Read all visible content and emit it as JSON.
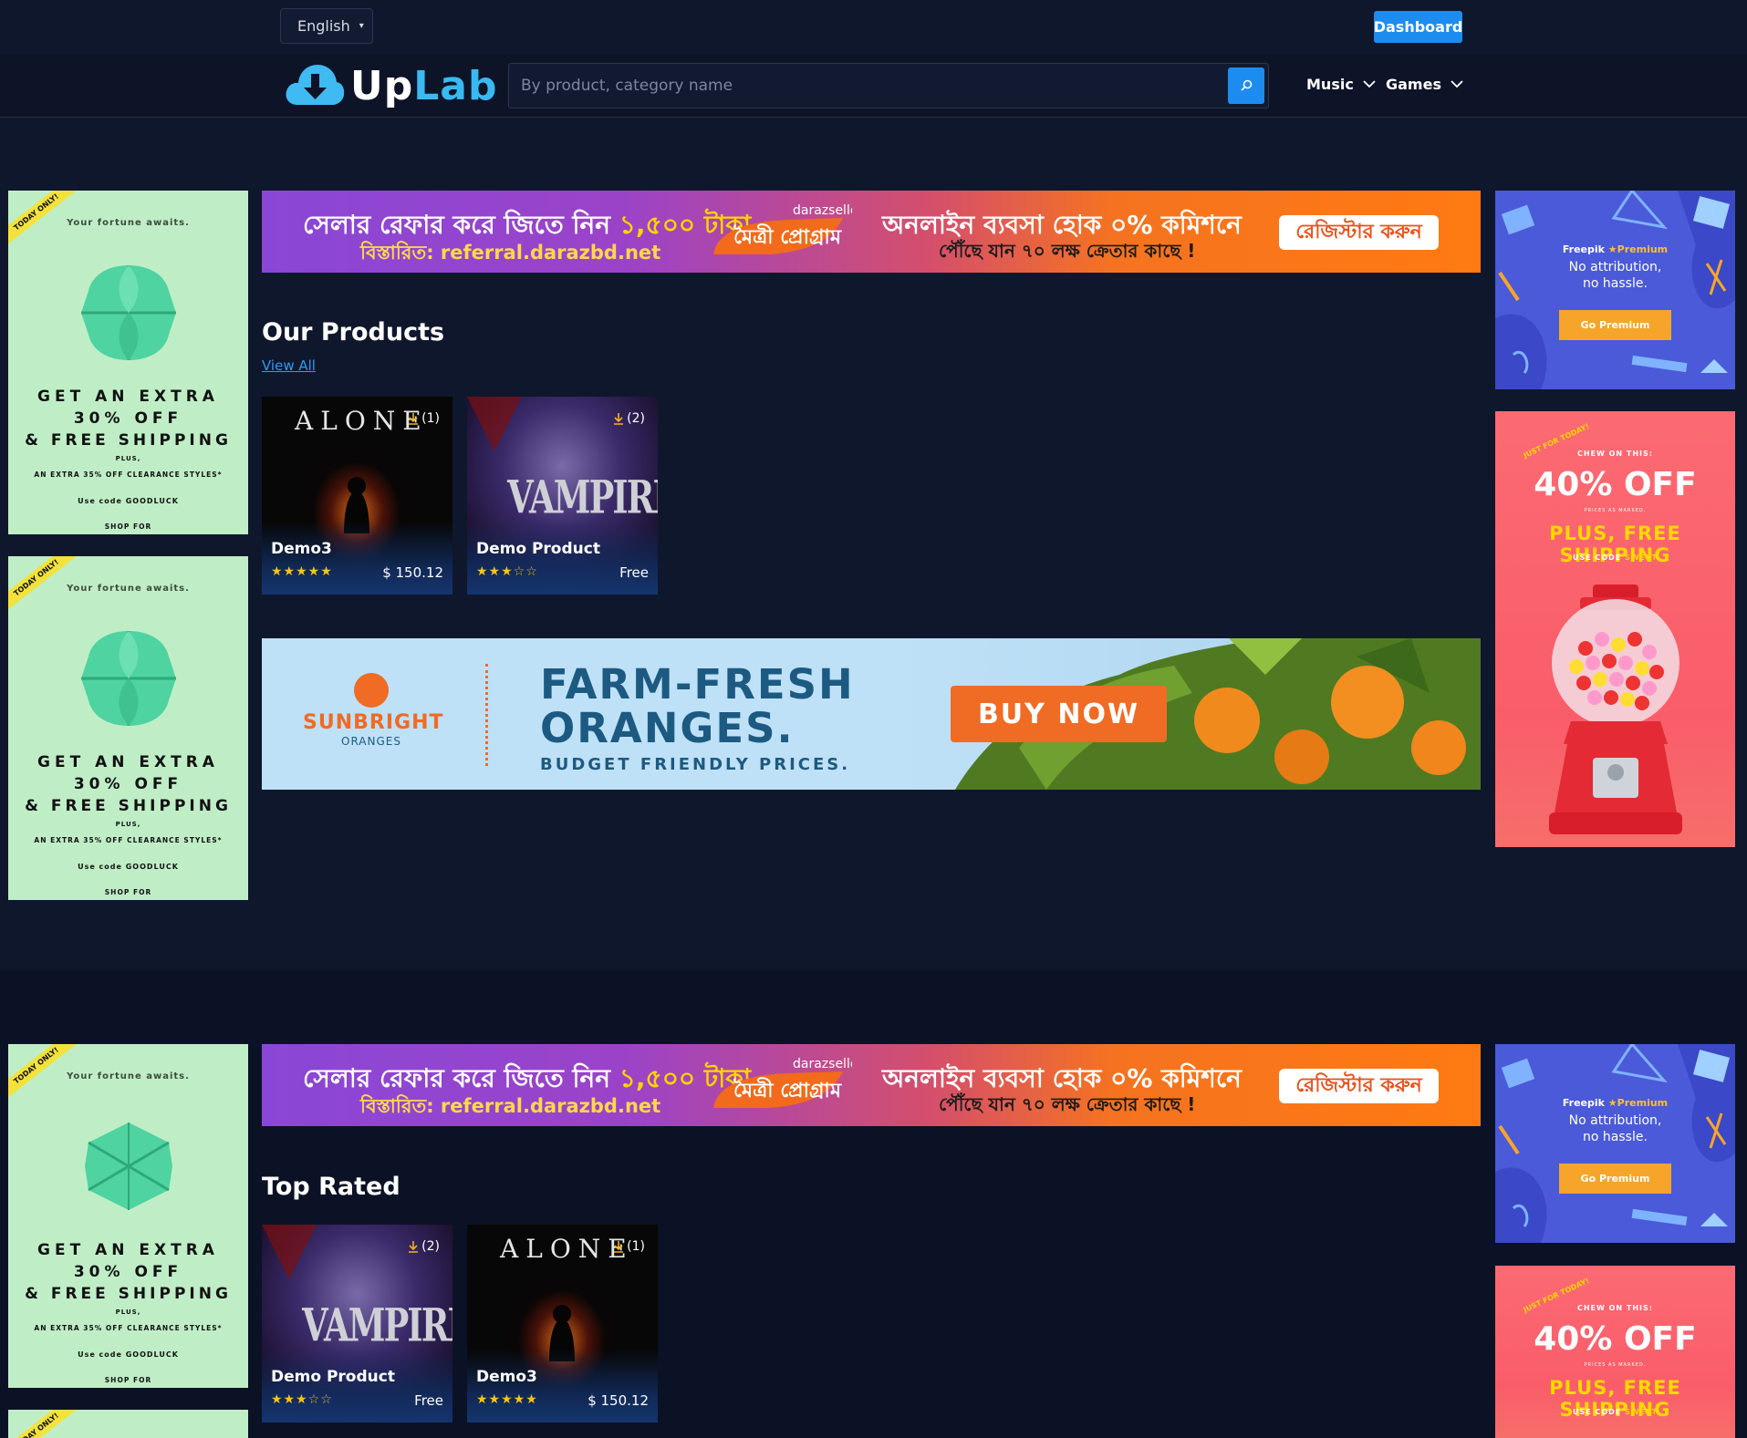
{
  "topbar": {
    "language": "English",
    "dashboard_label": "Dashboard"
  },
  "header": {
    "logo_up": "Up",
    "logo_lab": "Lab",
    "search_placeholder": "By product, category name",
    "nav": [
      {
        "label": "Music"
      },
      {
        "label": "Games"
      }
    ]
  },
  "ads": {
    "left": {
      "ribbon": "TODAY ONLY!",
      "fortune": "Your fortune awaits.",
      "line1": "GET AN EXTRA",
      "line2": "30% OFF",
      "line3": "& FREE SHIPPING",
      "line4": "PLUS,",
      "line5": "AN EXTRA 35% OFF CLEARANCE STYLES*",
      "line6": "Use code GOODLUCK",
      "line7": "SHOP FOR"
    },
    "daraz": {
      "text1_a": "সেলার রেফার করে জিতে নিন ",
      "text1_b": "১,৫০০ টাকা",
      "text2": "বিস্তারিত: referral.darazbd.net",
      "badge_top": "darazseller",
      "badge_main": "মৈত্রী প্রোগ্রাম",
      "text3": "অনলাইন ব্যবসা হোক ০% কমিশনে",
      "text4": "পৌঁছে যান ৭০ লক্ষ ক্রেতার কাছে !",
      "register": "রেজিস্টার করুন"
    },
    "freepik": {
      "brand": "Freepik",
      "premium": "Premium",
      "msg1": "No attribution,",
      "msg2": "no hassle.",
      "button": "Go Premium"
    },
    "gum": {
      "just": "JUST FOR TODAY!",
      "chew": "CHEW ON THIS:",
      "off": "40% OFF",
      "prices": "PRICES AS MARKED.",
      "plus": "PLUS, FREE SHIPPING",
      "code_label": "USE CODE",
      "code": "SWEET"
    },
    "oranges": {
      "brand": "SUNBRIGHT",
      "brand_sub": "ORANGES",
      "headline1": "FARM-FRESH",
      "headline2": "ORANGES.",
      "tagline": "BUDGET FRIENDLY PRICES.",
      "button": "BUY NOW"
    }
  },
  "sections": {
    "our_products": {
      "title": "Our Products",
      "view_all": "View All",
      "cards": [
        {
          "name": "Demo3",
          "art": "ALONE",
          "downloads": "(1)",
          "price": "$ 150.12",
          "rating": 5
        },
        {
          "name": "Demo Product",
          "art": "VAMPIRE",
          "downloads": "(2)",
          "price": "Free",
          "rating": 3
        }
      ]
    },
    "top_rated": {
      "title": "Top Rated",
      "cards": [
        {
          "name": "Demo Product",
          "art": "VAMPIRE",
          "downloads": "(2)",
          "price": "Free",
          "rating": 3
        },
        {
          "name": "Demo3",
          "art": "ALONE",
          "downloads": "(1)",
          "price": "$ 150.12",
          "rating": 5
        }
      ]
    }
  },
  "colors": {
    "background": "#0f172c",
    "accent": "#1d8cf0",
    "logo_blue": "#39b9f2",
    "star": "#f5c518"
  }
}
